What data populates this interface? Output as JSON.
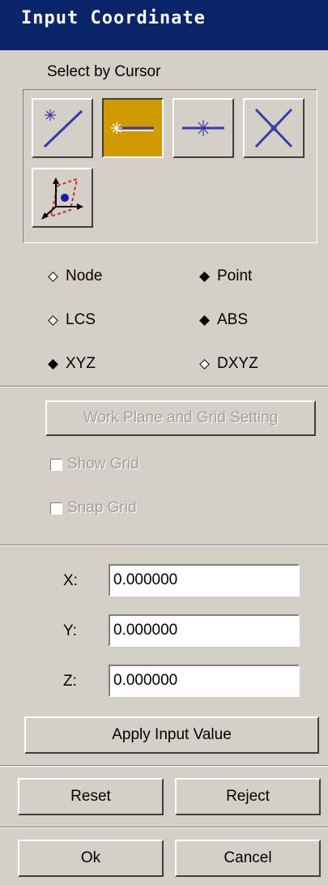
{
  "window": {
    "title": "Input Coordinate"
  },
  "cursor": {
    "label": "Select by Cursor",
    "tools": [
      {
        "icon": "line-end-point-icon",
        "active": false
      },
      {
        "icon": "line-start-point-icon",
        "active": true
      },
      {
        "icon": "line-mid-point-icon",
        "active": false
      },
      {
        "icon": "line-intersection-icon",
        "active": false
      },
      {
        "icon": "plane-axis-point-icon",
        "active": false
      }
    ]
  },
  "options": {
    "node": "Node",
    "point": "Point",
    "lcs": "LCS",
    "abs": "ABS",
    "xyz": "XYZ",
    "dxyz": "DXYZ",
    "selected": [
      "Point",
      "ABS",
      "XYZ"
    ]
  },
  "grid": {
    "work_plane_label": "Work Plane and Grid Setting",
    "show_grid": "Show Grid",
    "snap_grid": "Snap Grid"
  },
  "coords": {
    "x_label": "X:",
    "x_value": "0.000000",
    "y_label": "Y:",
    "y_value": "0.000000",
    "z_label": "Z:",
    "z_value": "0.000000"
  },
  "actions": {
    "apply": "Apply Input Value",
    "reset": "Reset",
    "reject": "Reject",
    "ok": "Ok",
    "cancel": "Cancel"
  },
  "colors": {
    "active_tool": "#d19b00",
    "titlebar": "#0a246a",
    "line_icon": "#3a3aa8"
  }
}
